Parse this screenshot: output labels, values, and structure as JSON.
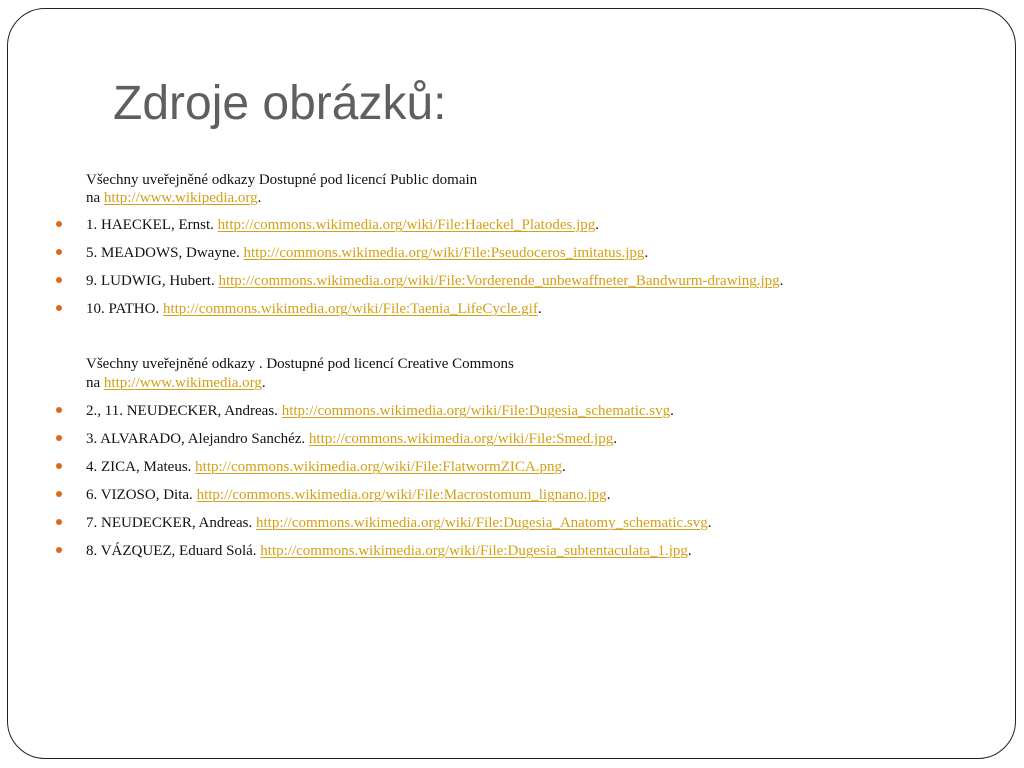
{
  "slide": {
    "title": "Zdroje obrázků:",
    "section1": {
      "intro_line1": "Všechny uveřejněné odkazy Dostupné pod licencí Public domain",
      "intro_prefix": "na",
      "intro_link": "http://www.wikipedia.org",
      "intro_suffix": ".",
      "items": [
        {
          "text": "1. HAECKEL, Ernst. ",
          "link": "http://commons.wikimedia.org/wiki/File:Haeckel_Platodes.jpg",
          "suffix": "."
        },
        {
          "text": "5. MEADOWS, Dwayne. ",
          "link": "http://commons.wikimedia.org/wiki/File:Pseudoceros_imitatus.jpg",
          "suffix": "."
        },
        {
          "text": "9. LUDWIG, Hubert. ",
          "link": "http://commons.wikimedia.org/wiki/File:Vorderende_unbewaffneter_Bandwurm-drawing.jpg",
          "suffix": "."
        },
        {
          "text": "10. PATHO. ",
          "link": "http://commons.wikimedia.org/wiki/File:Taenia_LifeCycle.gif",
          "suffix": "."
        }
      ]
    },
    "section2": {
      "intro_line1": "Všechny uveřejněné odkazy . Dostupné pod licencí Creative Commons",
      "intro_prefix": "na",
      "intro_link": "http://www.wikimedia.org",
      "intro_suffix": ".",
      "items": [
        {
          "text": "2., 11.  NEUDECKER, Andreas. ",
          "link": "http://commons.wikimedia.org/wiki/File:Dugesia_schematic.svg",
          "suffix": "."
        },
        {
          "text": "3. ALVARADO, Alejandro Sanchéz. ",
          "link": "http://commons.wikimedia.org/wiki/File:Smed.jpg",
          "suffix": "."
        },
        {
          "text": "4. ZICA, Mateus. ",
          "link": "http://commons.wikimedia.org/wiki/File:FlatwormZICA.png",
          "suffix": "."
        },
        {
          "text": "6. VIZOSO, Dita. ",
          "link": "http://commons.wikimedia.org/wiki/File:Macrostomum_lignano.jpg",
          "suffix": "."
        },
        {
          "text": "7. NEUDECKER, Andreas. ",
          "link": "http://commons.wikimedia.org/wiki/File:Dugesia_Anatomy_schematic.svg",
          "suffix": "."
        },
        {
          "text": "8. VÁZQUEZ, Eduard Solá. ",
          "link": "http://commons.wikimedia.org/wiki/File:Dugesia_subtentaculata_1.jpg",
          "suffix": "."
        }
      ]
    },
    "colors": {
      "bullet": "#e06a1a",
      "link": "#d4a017",
      "title": "#5f5f5f"
    }
  }
}
